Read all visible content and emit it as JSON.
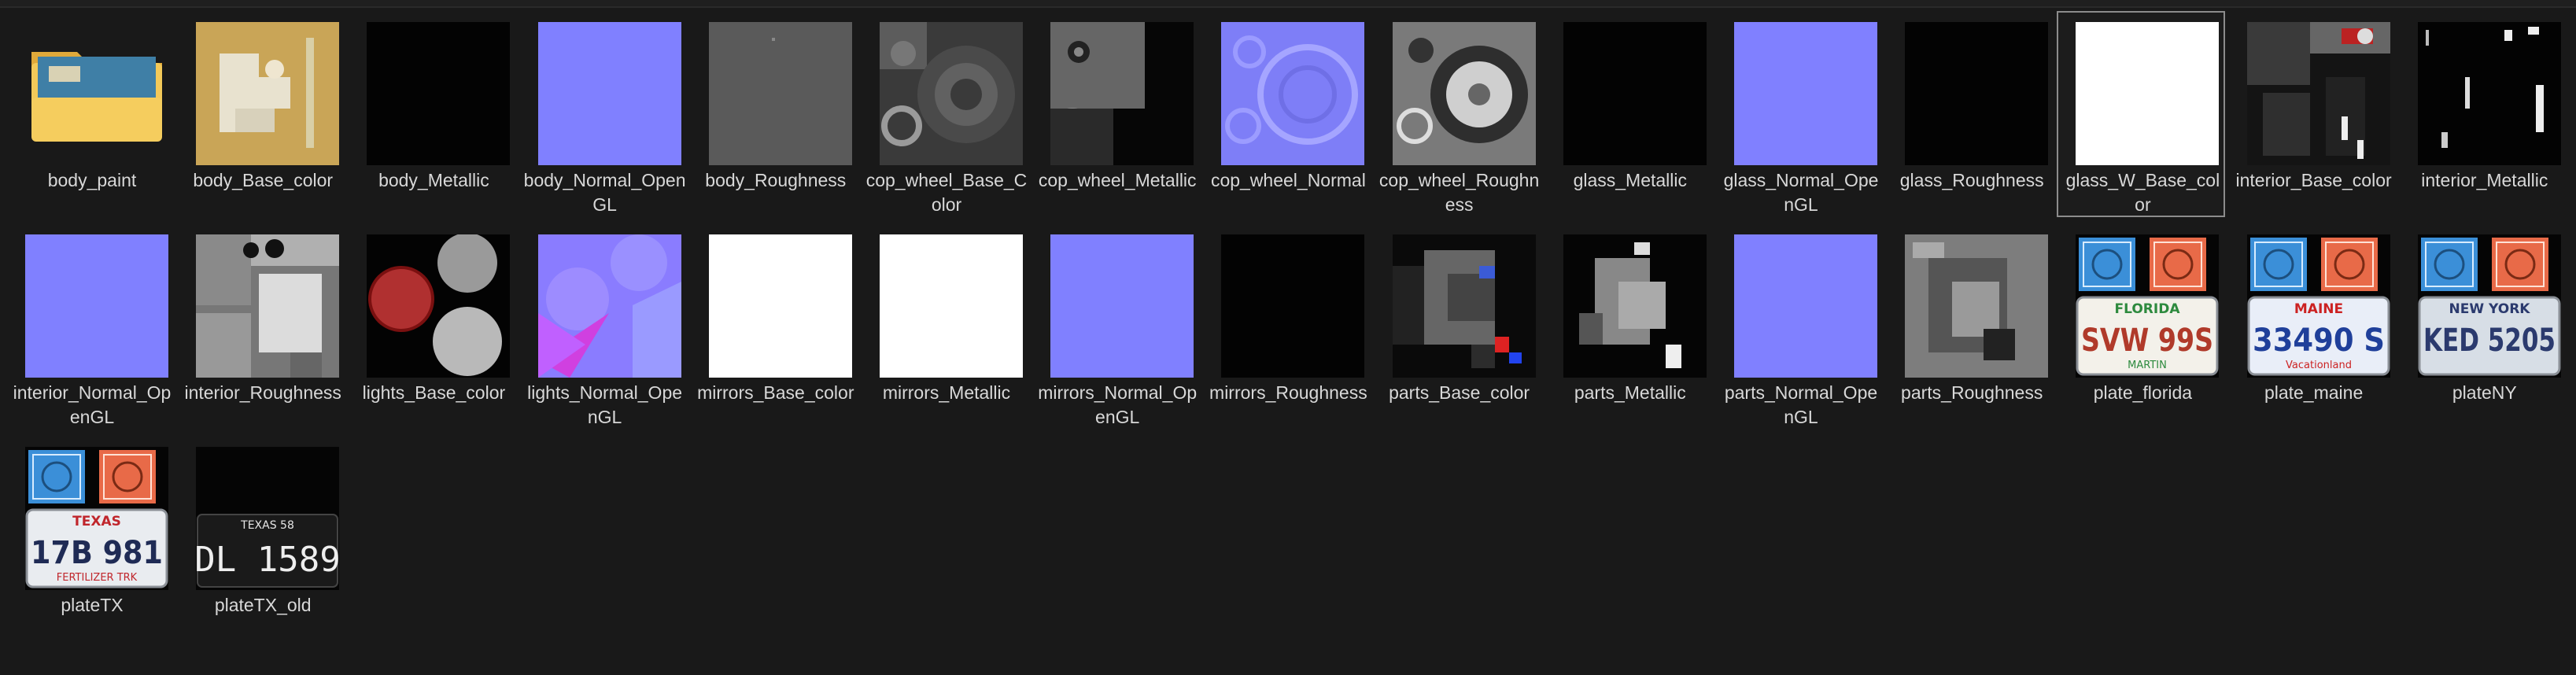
{
  "files": [
    {
      "name": "body_paint",
      "icon": "folder-icon"
    },
    {
      "name": "body_Base_color",
      "icon": "texture-yellow"
    },
    {
      "name": "body_Metallic",
      "icon": "texture-black"
    },
    {
      "name": "body_Normal_OpenGL",
      "icon": "texture-normal"
    },
    {
      "name": "body_Roughness",
      "icon": "texture-gray"
    },
    {
      "name": "cop_wheel_Base_Color",
      "icon": "texture-wheel-gray"
    },
    {
      "name": "cop_wheel_Metallic",
      "icon": "texture-wheel-dark"
    },
    {
      "name": "cop_wheel_Normal",
      "icon": "texture-wheel-normal"
    },
    {
      "name": "cop_wheel_Roughness",
      "icon": "texture-wheel-light"
    },
    {
      "name": "glass_Metallic",
      "icon": "texture-black"
    },
    {
      "name": "glass_Normal_OpenGL",
      "icon": "texture-normal"
    },
    {
      "name": "glass_Roughness",
      "icon": "texture-black"
    },
    {
      "name": "glass_W_Base_color",
      "icon": "texture-white"
    },
    {
      "name": "interior_Base_color",
      "icon": "texture-interior"
    },
    {
      "name": "interior_Metallic",
      "icon": "texture-interior-metal"
    },
    {
      "name": "interior_Normal_OpenGL",
      "icon": "texture-normal"
    },
    {
      "name": "interior_Roughness",
      "icon": "texture-interior-rough"
    },
    {
      "name": "lights_Base_color",
      "icon": "texture-lights"
    },
    {
      "name": "lights_Normal_OpenGL",
      "icon": "texture-lights-normal"
    },
    {
      "name": "mirrors_Base_color",
      "icon": "texture-white"
    },
    {
      "name": "mirrors_Metallic",
      "icon": "texture-white"
    },
    {
      "name": "mirrors_Normal_OpenGL",
      "icon": "texture-normal"
    },
    {
      "name": "mirrors_Roughness",
      "icon": "texture-black"
    },
    {
      "name": "parts_Base_color",
      "icon": "texture-parts"
    },
    {
      "name": "parts_Metallic",
      "icon": "texture-parts-metal"
    },
    {
      "name": "parts_Normal_OpenGL",
      "icon": "texture-normal"
    },
    {
      "name": "parts_Roughness",
      "icon": "texture-parts-rough"
    },
    {
      "name": "plate_florida",
      "icon": "plate-florida",
      "plate_text": "SVW 99S",
      "plate_state": "FLORIDA",
      "plate_bottom": "MARTIN"
    },
    {
      "name": "plate_maine",
      "icon": "plate-maine",
      "plate_text": "33490 S",
      "plate_state": "MAINE",
      "plate_bottom": "Vacationland"
    },
    {
      "name": "plateNY",
      "icon": "plate-ny",
      "plate_text": "KED 5205",
      "plate_state": "NEW YORK"
    },
    {
      "name": "plateTX",
      "icon": "plate-tx",
      "plate_text": "17B 981",
      "plate_state": "TEXAS",
      "plate_bottom": "FERTILIZER TRK"
    },
    {
      "name": "plateTX_old",
      "icon": "plate-tx-old",
      "plate_text": "DL 1589",
      "plate_state": "TEXAS 58"
    }
  ],
  "selected": "glass_W_Base_color",
  "colors": {
    "background": "#191919",
    "text": "#d8d8d8",
    "normal_map": "#8080ff",
    "folder": "#f1c24f",
    "body_base": "#c9a557",
    "selection_border": "#8c8c8c"
  }
}
